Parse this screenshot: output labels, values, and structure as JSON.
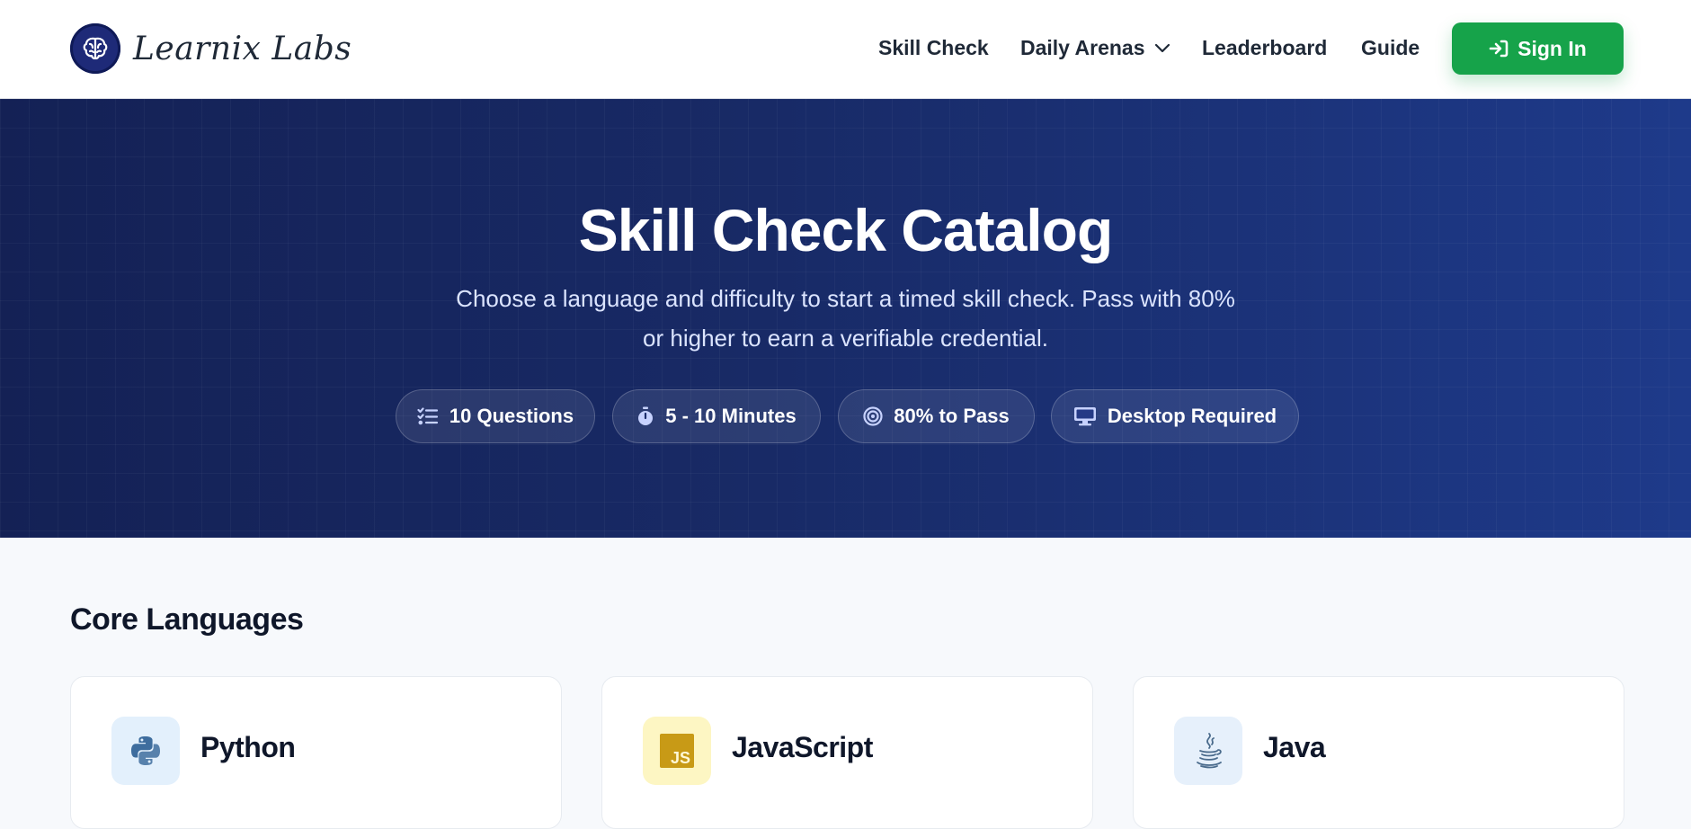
{
  "header": {
    "brand_name": "Learnix Labs",
    "nav": {
      "skill_check": "Skill Check",
      "daily_arenas": "Daily Arenas",
      "leaderboard": "Leaderboard",
      "guide": "Guide"
    },
    "sign_in_label": "Sign In"
  },
  "hero": {
    "title": "Skill Check Catalog",
    "subtitle_line1": "Choose a language and difficulty to start a timed skill check. Pass with 80%",
    "subtitle_line2": "or higher to earn a verifiable credential.",
    "pills": [
      {
        "label": "10 Questions",
        "icon": "list-check-icon"
      },
      {
        "label": "5 - 10 Minutes",
        "icon": "stopwatch-icon"
      },
      {
        "label": "80% to Pass",
        "icon": "target-icon"
      },
      {
        "label": "Desktop Required",
        "icon": "monitor-icon"
      }
    ]
  },
  "main": {
    "section_title": "Core Languages",
    "cards": [
      {
        "name": "Python",
        "icon": "python-icon"
      },
      {
        "name": "JavaScript",
        "icon": "javascript-icon",
        "icon_text": "JS"
      },
      {
        "name": "Java",
        "icon": "java-icon"
      }
    ]
  },
  "colors": {
    "accent_green": "#16a34a",
    "hero_dark": "#142155",
    "hero_light": "#1e3a8a",
    "brand_navy": "#1e2a78"
  }
}
